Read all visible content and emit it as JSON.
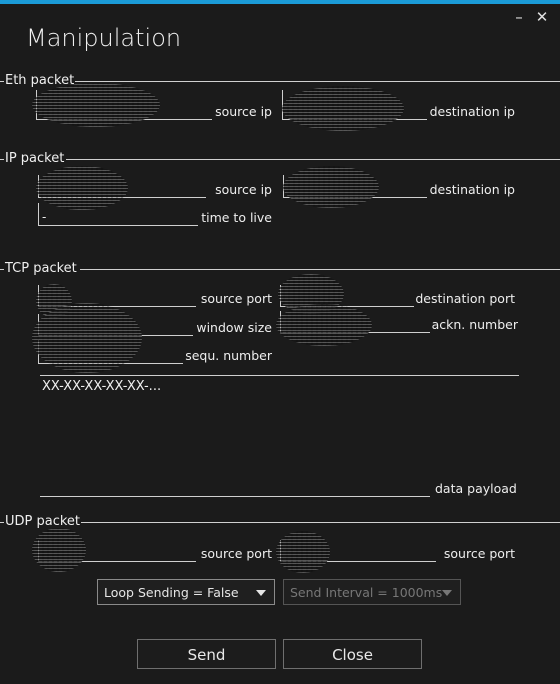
{
  "window": {
    "title": "Manipulation",
    "minimize_icon": "minimize-icon",
    "close_icon": "close-icon",
    "accent_color": "#1b9bd7"
  },
  "eth": {
    "header": "Eth packet",
    "source_ip_label": "source ip",
    "destination_ip_label": "destination ip"
  },
  "ip": {
    "header": "IP packet",
    "source_ip_label": "source ip",
    "destination_ip_label": "destination ip",
    "ttl_label": "time to live",
    "ttl_value": "-"
  },
  "tcp": {
    "header": "TCP packet",
    "source_port_label": "source port",
    "destination_port_label": "destination port",
    "window_size_label": "window size",
    "ackn_number_label": "ackn. number",
    "sequ_number_label": "sequ. number",
    "payload_value": "XX-XX-XX-XX-XX-...",
    "payload_label": "data payload"
  },
  "udp": {
    "header": "UDP packet",
    "source_port_label": "source port",
    "source_port2_label": "source port"
  },
  "controls": {
    "loop_sending": "Loop Sending = False",
    "send_interval": "Send Interval = 1000ms",
    "send_label": "Send",
    "close_label": "Close"
  }
}
